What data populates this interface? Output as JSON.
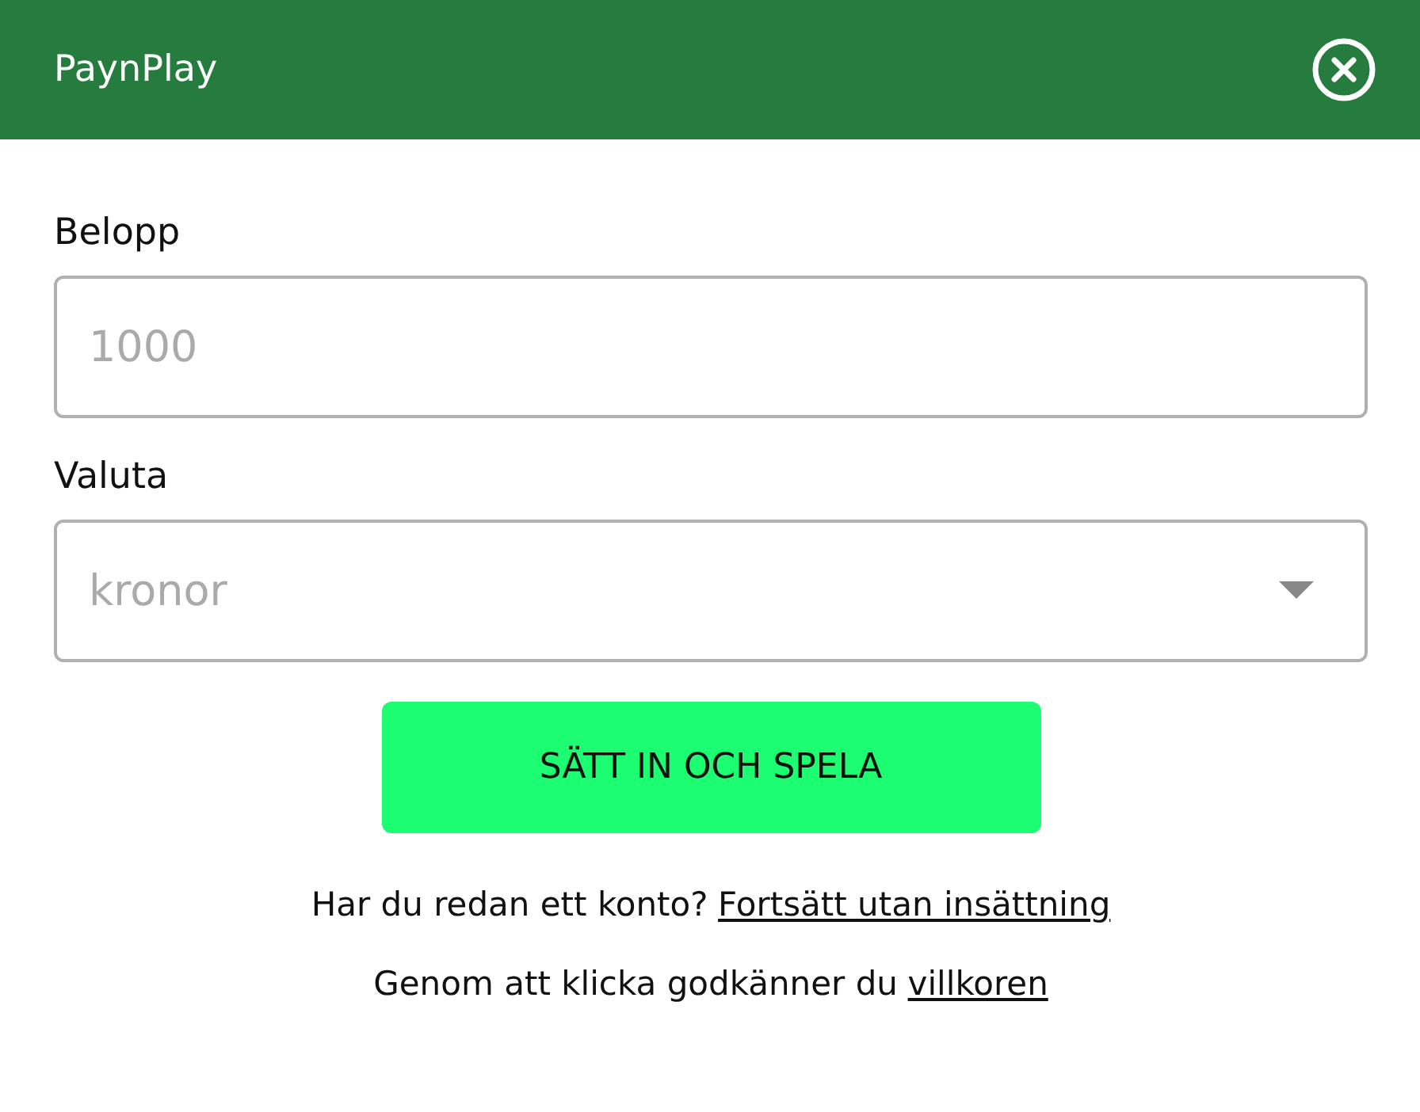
{
  "header": {
    "title": "PaynPlay"
  },
  "amount": {
    "label": "Belopp",
    "placeholder": "1000"
  },
  "currency": {
    "label": "Valuta",
    "placeholder": "kronor"
  },
  "submit": "SÄTT IN OCH SPELA",
  "notes": [
    {
      "text": "Har du redan ett konto?",
      "link": "Fortsätt utan insättning"
    },
    {
      "text": "Genom att klicka godkänner du",
      "link": "villkoren"
    }
  ]
}
